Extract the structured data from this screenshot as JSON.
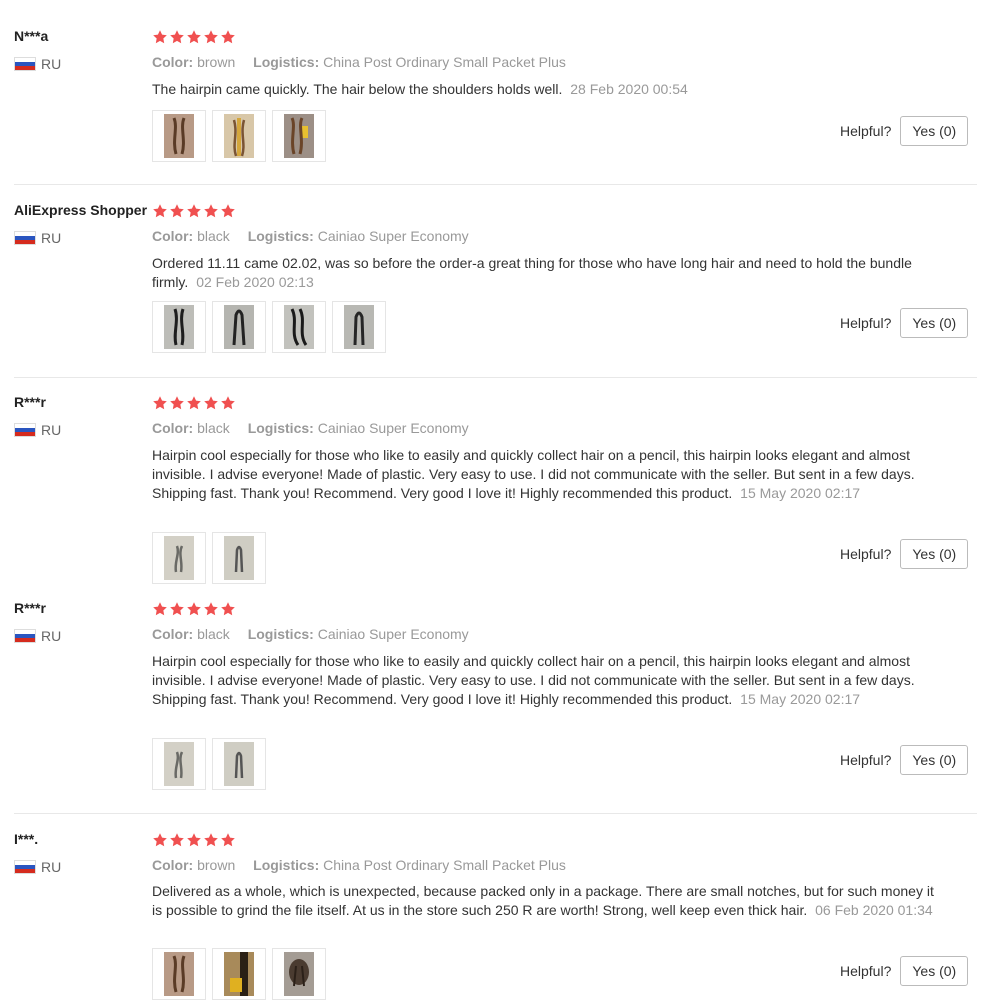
{
  "labels": {
    "color": "Color:",
    "logistics": "Logistics:",
    "helpful": "Helpful?"
  },
  "accent": {
    "star": "#f05050"
  },
  "reviews": [
    {
      "name": "N***a",
      "country": "RU",
      "color": "brown",
      "logistics": "China Post Ordinary Small Packet Plus",
      "text": "The hairpin came quickly. The hair below the shoulders holds well.",
      "date": "28 Feb 2020 00:54",
      "helpful": "Yes (0)",
      "rating": 5
    },
    {
      "name": "AliExpress Shopper",
      "country": "RU",
      "color": "black",
      "logistics": "Cainiao Super Economy",
      "text": "Ordered 11.11 came 02.02, was so before the order-a great thing for those who have long hair and need to hold the bundle firmly.",
      "date": "02 Feb 2020 02:13",
      "helpful": "Yes (0)",
      "rating": 5
    },
    {
      "name": "R***r",
      "country": "RU",
      "color": "black",
      "logistics": "Cainiao Super Economy",
      "text": "Hairpin cool especially for those who like to easily and quickly collect hair on a pencil, this hairpin looks elegant and almost invisible. I advise everyone! Made of plastic. Very easy to use. I did not communicate with the seller. But sent in a few days. Shipping fast. Thank you! Recommend. Very good I love it! Highly recommended this product.",
      "date": "15 May 2020 02:17",
      "helpful": "Yes (0)",
      "rating": 5
    },
    {
      "name": "R***r",
      "country": "RU",
      "color": "black",
      "logistics": "Cainiao Super Economy",
      "text": "Hairpin cool especially for those who like to easily and quickly collect hair on a pencil, this hairpin looks elegant and almost invisible. I advise everyone! Made of plastic. Very easy to use. I did not communicate with the seller. But sent in a few days. Shipping fast. Thank you! Recommend. Very good I love it! Highly recommended this product.",
      "date": "15 May 2020 02:17",
      "helpful": "Yes (0)",
      "rating": 5
    },
    {
      "name": "I***.",
      "country": "RU",
      "color": "brown",
      "logistics": "China Post Ordinary Small Packet Plus",
      "text": "Delivered as a whole, which is unexpected, because packed only in a package. There are small notches, but for such money it is possible to grind the file itself. At us in the store such 250 R are worth! Strong, well keep even thick hair.",
      "date": "06 Feb 2020 01:34",
      "helpful": "Yes (0)",
      "rating": 5
    }
  ]
}
